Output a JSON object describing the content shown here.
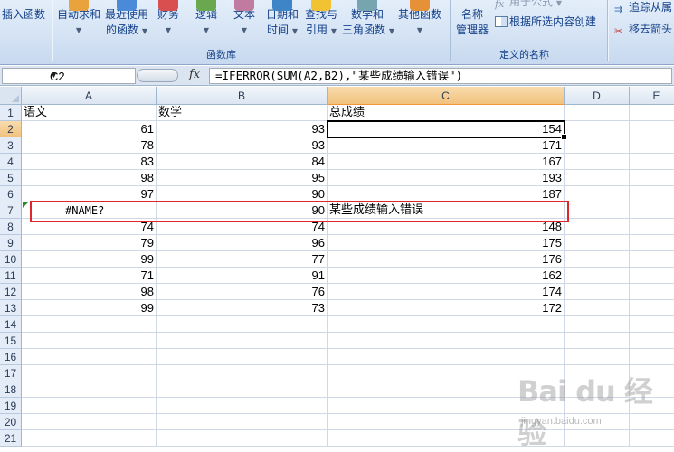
{
  "ribbon": {
    "insert_function": "插入函数",
    "autosum": "自动求和",
    "recently_used": [
      "最近使用",
      "的函数"
    ],
    "financial": "财务",
    "logical": "逻辑",
    "text": "文本",
    "datetime": [
      "日期和",
      "时间"
    ],
    "lookup": [
      "查找与",
      "引用"
    ],
    "math": [
      "数学和",
      "三角函数"
    ],
    "other": "其他函数",
    "name_manager": [
      "名称",
      "管理器"
    ],
    "use_in_formula": "用于公式",
    "create_from_selection": "根据所选内容创建",
    "group_function_library": "函数库",
    "group_defined_names": "定义的名称",
    "trace_precedents": "追踪从属",
    "remove_arrows": "移去箭头",
    "icon_colors": [
      "#e8a33d",
      "#4a8ad8",
      "#d94f4f",
      "#6aa84f",
      "#c27ba0",
      "#3d85c6",
      "#f1c232",
      "#76a5af",
      "#e69138"
    ]
  },
  "formula_bar": {
    "name_box": "C2",
    "fx_label": "fx",
    "formula": "=IFERROR(SUM(A2,B2),\"某些成绩输入错误\")"
  },
  "columns": [
    "A",
    "B",
    "C",
    "D",
    "E"
  ],
  "selected_column": "C",
  "selected_row": "2",
  "rows": [
    {
      "n": "1",
      "a": "语文",
      "b": "数学",
      "c": "总成绩"
    },
    {
      "n": "2",
      "a": "61",
      "b": "93",
      "c": "154"
    },
    {
      "n": "3",
      "a": "78",
      "b": "93",
      "c": "171"
    },
    {
      "n": "4",
      "a": "83",
      "b": "84",
      "c": "167"
    },
    {
      "n": "5",
      "a": "98",
      "b": "95",
      "c": "193"
    },
    {
      "n": "6",
      "a": "97",
      "b": "90",
      "c": "187"
    },
    {
      "n": "7",
      "a": "#NAME?",
      "b": "90",
      "c": "某些成绩输入错误"
    },
    {
      "n": "8",
      "a": "74",
      "b": "74",
      "c": "148"
    },
    {
      "n": "9",
      "a": "79",
      "b": "96",
      "c": "175"
    },
    {
      "n": "10",
      "a": "99",
      "b": "77",
      "c": "176"
    },
    {
      "n": "11",
      "a": "71",
      "b": "91",
      "c": "162"
    },
    {
      "n": "12",
      "a": "98",
      "b": "76",
      "c": "174"
    },
    {
      "n": "13",
      "a": "99",
      "b": "73",
      "c": "172"
    },
    {
      "n": "14",
      "a": "",
      "b": "",
      "c": ""
    },
    {
      "n": "15",
      "a": "",
      "b": "",
      "c": ""
    },
    {
      "n": "16",
      "a": "",
      "b": "",
      "c": ""
    },
    {
      "n": "17",
      "a": "",
      "b": "",
      "c": ""
    },
    {
      "n": "18",
      "a": "",
      "b": "",
      "c": ""
    },
    {
      "n": "19",
      "a": "",
      "b": "",
      "c": ""
    },
    {
      "n": "20",
      "a": "",
      "b": "",
      "c": ""
    },
    {
      "n": "21",
      "a": "",
      "b": "",
      "c": ""
    }
  ],
  "watermark": {
    "logo": "Bai du 经验",
    "sub": "jingyan.baidu.com"
  }
}
